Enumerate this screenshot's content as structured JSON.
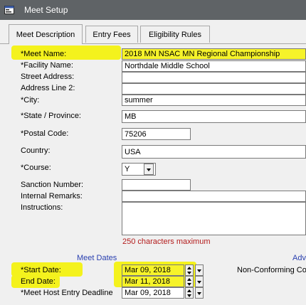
{
  "window": {
    "title": "Meet Setup",
    "icon": "window-app-icon"
  },
  "tabs": [
    {
      "label": "Meet Description",
      "active": true
    },
    {
      "label": "Entry Fees",
      "active": false
    },
    {
      "label": "Eligibility Rules",
      "active": false
    }
  ],
  "form": {
    "meet_name": {
      "label": "*Meet Name:",
      "value": "2018 MN NSAC MN Regional Championship"
    },
    "facility_name": {
      "label": "*Facility Name:",
      "value": "Northdale Middle School"
    },
    "street_address": {
      "label": "Street Address:",
      "value": ""
    },
    "address_line2": {
      "label": "Address Line 2:",
      "value": ""
    },
    "city": {
      "label": "*City:",
      "value": "summer"
    },
    "state": {
      "label": "*State / Province:",
      "value": "MB"
    },
    "postal_code": {
      "label": "*Postal Code:",
      "value": "75206"
    },
    "country": {
      "label": "Country:",
      "value": "USA"
    },
    "course": {
      "label": "*Course:",
      "value": "Y"
    },
    "sanction_number": {
      "label": "Sanction Number:",
      "value": ""
    },
    "internal_remarks": {
      "label": "Internal Remarks:",
      "value": ""
    },
    "instructions": {
      "label": "Instructions:",
      "value": ""
    },
    "instructions_limit": "250 characters maximum"
  },
  "meet_dates": {
    "heading": "Meet Dates",
    "advanced_heading": "Adv",
    "start_date": {
      "label": "*Start Date:",
      "value": "Mar 09, 2018"
    },
    "end_date": {
      "label": "End Date:",
      "value": "Mar 11, 2018"
    },
    "entry_deadline": {
      "label": "*Meet Host Entry Deadline",
      "value": "Mar 09, 2018"
    },
    "non_conforming_label": "Non-Conforming Cou"
  },
  "colors": {
    "highlight": "#f4f21d",
    "title_bar": "#5f6366",
    "section_link": "#2a40b0",
    "note": "#b31b1b"
  }
}
